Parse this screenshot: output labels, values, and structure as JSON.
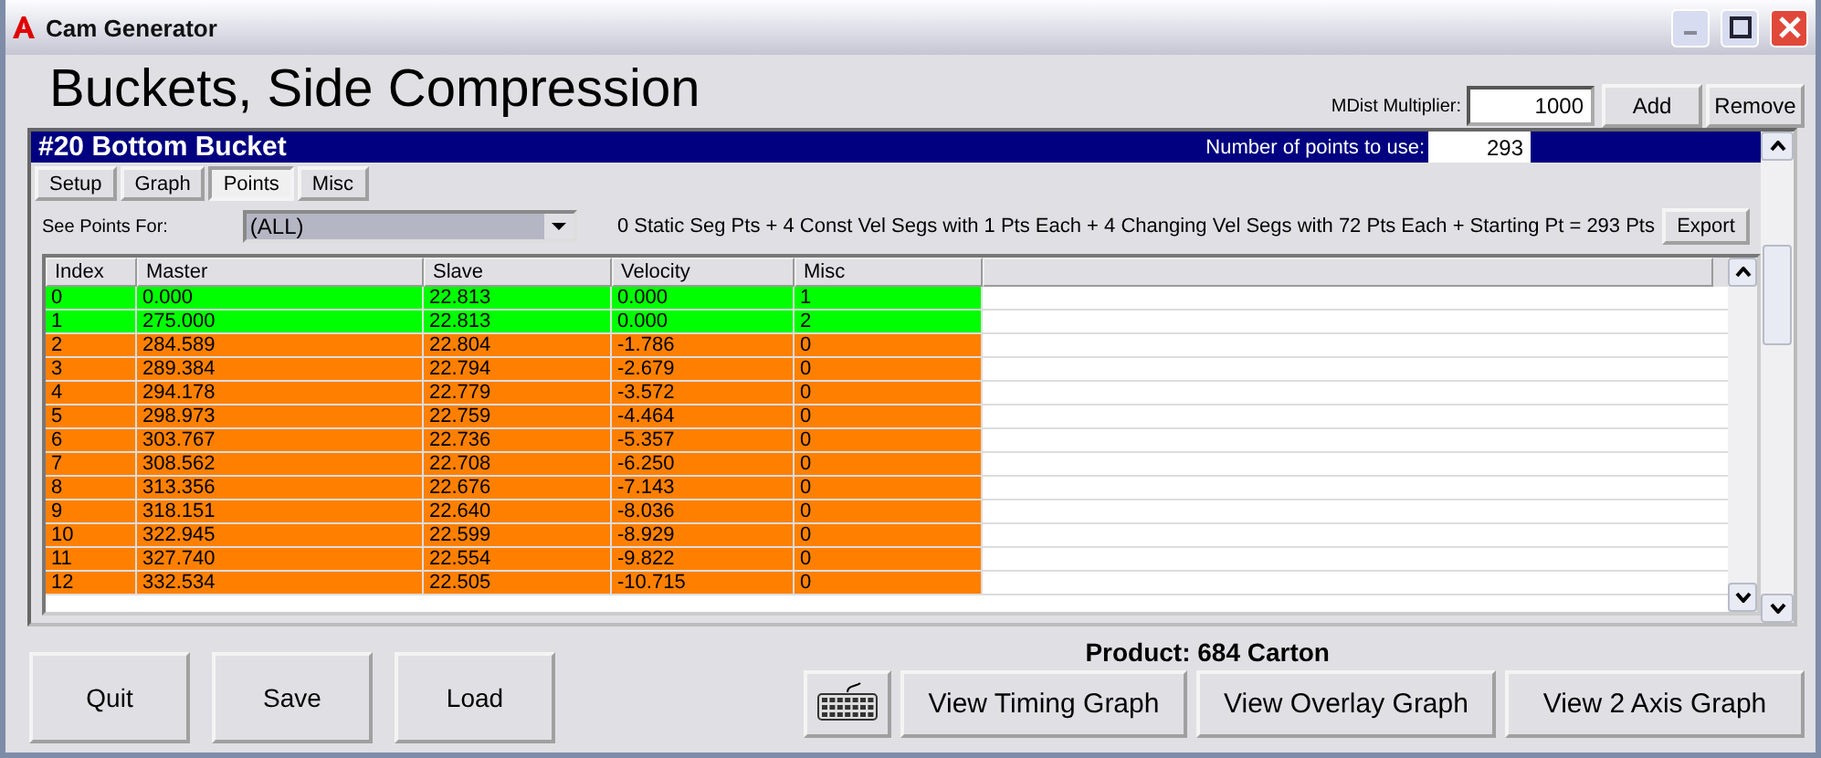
{
  "window": {
    "title": "Cam Generator"
  },
  "heading": "Buckets, Side Compression",
  "mdist": {
    "label": "MDist Multiplier:",
    "value": "1000"
  },
  "top_buttons": [
    "Add",
    "Remove"
  ],
  "cam": {
    "title": "#20  Bottom Bucket",
    "points_label": "Number of points to use:",
    "points_value": "293"
  },
  "tabs": [
    {
      "label": "Setup",
      "selected": false
    },
    {
      "label": "Graph",
      "selected": false
    },
    {
      "label": "Points",
      "selected": true
    },
    {
      "label": "Misc",
      "selected": false
    }
  ],
  "see_points": {
    "label": "See Points For:",
    "value": "(ALL)"
  },
  "summary": "0 Static Seg Pts + 4 Const Vel Segs with 1 Pts Each + 4 Changing Vel Segs with 72 Pts Each + Starting Pt = 293 Pts",
  "export_button": "Export",
  "table": {
    "columns": [
      "Index",
      "Master",
      "Slave",
      "Velocity",
      "Misc"
    ],
    "rows": [
      {
        "color": "#00ff00",
        "cells": [
          "0",
          "0.000",
          "22.813",
          "0.000",
          "1"
        ]
      },
      {
        "color": "#00ff00",
        "cells": [
          "1",
          "275.000",
          "22.813",
          "0.000",
          "2"
        ]
      },
      {
        "color": "#ff8000",
        "cells": [
          "2",
          "284.589",
          "22.804",
          "-1.786",
          "0"
        ]
      },
      {
        "color": "#ff8000",
        "cells": [
          "3",
          "289.384",
          "22.794",
          "-2.679",
          "0"
        ]
      },
      {
        "color": "#ff8000",
        "cells": [
          "4",
          "294.178",
          "22.779",
          "-3.572",
          "0"
        ]
      },
      {
        "color": "#ff8000",
        "cells": [
          "5",
          "298.973",
          "22.759",
          "-4.464",
          "0"
        ]
      },
      {
        "color": "#ff8000",
        "cells": [
          "6",
          "303.767",
          "22.736",
          "-5.357",
          "0"
        ]
      },
      {
        "color": "#ff8000",
        "cells": [
          "7",
          "308.562",
          "22.708",
          "-6.250",
          "0"
        ]
      },
      {
        "color": "#ff8000",
        "cells": [
          "8",
          "313.356",
          "22.676",
          "-7.143",
          "0"
        ]
      },
      {
        "color": "#ff8000",
        "cells": [
          "9",
          "318.151",
          "22.640",
          "-8.036",
          "0"
        ]
      },
      {
        "color": "#ff8000",
        "cells": [
          "10",
          "322.945",
          "22.599",
          "-8.929",
          "0"
        ]
      },
      {
        "color": "#ff8000",
        "cells": [
          "11",
          "327.740",
          "22.554",
          "-9.822",
          "0"
        ]
      },
      {
        "color": "#ff8000",
        "cells": [
          "12",
          "332.534",
          "22.505",
          "-10.715",
          "0"
        ]
      }
    ]
  },
  "product": "Product: 684 Carton",
  "left_buttons": [
    "Quit",
    "Save",
    "Load"
  ],
  "graph_buttons": [
    "View Timing Graph",
    "View Overlay Graph",
    "View 2 Axis Graph"
  ]
}
